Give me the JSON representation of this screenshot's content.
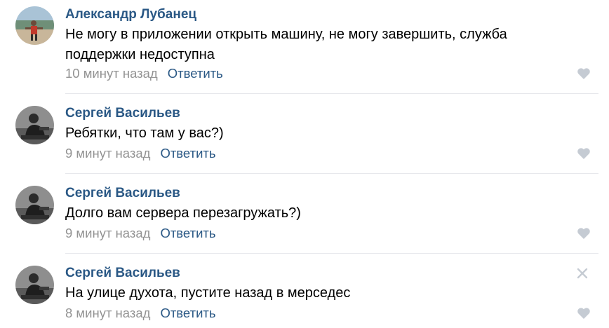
{
  "comments": [
    {
      "author": "Александр Лубанец",
      "text": "Не могу в приложении открыть машину, не могу завершить, служба поддержки недоступна",
      "time": "10 минут назад",
      "reply": "Ответить",
      "avatar_icon": "user-photo-beach",
      "like_icon": "heart-icon"
    },
    {
      "author": "Сергей Васильев",
      "text": "Ребятки, что там у вас?)",
      "time": "9 минут назад",
      "reply": "Ответить",
      "avatar_icon": "user-photo-bw",
      "like_icon": "heart-icon"
    },
    {
      "author": "Сергей Васильев",
      "text": "Долго вам сервера перезагружать?)",
      "time": "9 минут назад",
      "reply": "Ответить",
      "avatar_icon": "user-photo-bw",
      "like_icon": "heart-icon"
    },
    {
      "author": "Сергей Васильев",
      "text": "На улице духота, пустите назад в мерседес",
      "time": "8 минут назад",
      "reply": "Ответить",
      "avatar_icon": "user-photo-bw",
      "like_icon": "heart-icon",
      "close_icon": "close-icon"
    }
  ],
  "colors": {
    "link": "#2a5885",
    "time": "#939393",
    "icon": "#c5cbd3",
    "divider": "#e7e8ec"
  }
}
